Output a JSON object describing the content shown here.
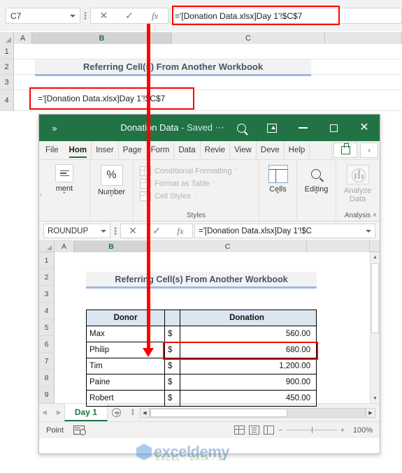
{
  "outer": {
    "name_box": "C7",
    "formula": "='[Donation Data.xlsx]Day 1'!$C$7",
    "columns": [
      "A",
      "B",
      "C"
    ],
    "rows": [
      "1",
      "2",
      "3",
      "4"
    ],
    "title_banner": "Referring Cell(s) From Another Workbook",
    "cell_b4_formula": "='[Donation Data.xlsx]Day 1'!$C$7"
  },
  "inner": {
    "titlebar": {
      "chevron": "»",
      "title": "Donation Data",
      "separator": "-",
      "saved_label": "Saved",
      "more_dots": "⋯",
      "search_icon": "search-icon",
      "present_icon": "present-icon",
      "minimize_icon": "minimize-icon",
      "maximize_icon": "maximize-icon",
      "close_icon": "close-icon"
    },
    "ribbon_tabs": [
      "File",
      "Hom",
      "Inser",
      "Page",
      "Form",
      "Data",
      "Revie",
      "View",
      "Deve",
      "Help"
    ],
    "active_tab": "Hom",
    "overflow_chevron": "›",
    "ribbon_groups": [
      {
        "caption": "ment",
        "label": "",
        "chev": "ˇ"
      },
      {
        "caption": "Number",
        "label": "",
        "chev": "ˇ",
        "glyph": "%"
      },
      {
        "caption": "",
        "label": "Styles",
        "items": [
          {
            "text": "Conditional Formatting",
            "chev": "ˇ"
          },
          {
            "text": "Format as Table",
            "chev": "ˇ"
          },
          {
            "text": "Cell Styles",
            "chev": "ˇ"
          }
        ]
      },
      {
        "caption": "Cells",
        "label": "",
        "chev": "ˇ"
      },
      {
        "caption": "Editing",
        "label": "",
        "chev": "ˇ"
      },
      {
        "caption": "Analyze Data",
        "label": "Analysis"
      }
    ],
    "collapse_ribbon": "˄",
    "formula_bar": {
      "name_box": "ROUNDUP",
      "formula": "='[Donation Data.xlsx]Day 1'!$C",
      "expand_chev": "ˇ"
    },
    "columns": [
      "A",
      "B",
      "C"
    ],
    "rows": [
      "1",
      "2",
      "3",
      "4",
      "5",
      "6",
      "7",
      "8",
      "9"
    ],
    "title_banner": "Referring Cell(s) From Another Workbook",
    "table": {
      "headers": [
        "Donor",
        "",
        "Donation"
      ],
      "currency_symbol": "$",
      "rows": [
        {
          "donor": "Max",
          "currency": "$",
          "amount": "560.00"
        },
        {
          "donor": "Philip",
          "currency": "$",
          "amount": "680.00"
        },
        {
          "donor": "Tim",
          "currency": "$",
          "amount": "1,200.00"
        },
        {
          "donor": "Paine",
          "currency": "$",
          "amount": "900.00"
        },
        {
          "donor": "Robert",
          "currency": "$",
          "amount": "450.00"
        }
      ],
      "highlighted_row_index": 2
    },
    "sheet_tabs": {
      "active": "Day 1",
      "add_label": "new-sheet",
      "prev_icon": "◀",
      "next_icon": "▶"
    },
    "status": {
      "mode": "Point",
      "macro_record": "macro-record-icon",
      "zoom": "100%",
      "zoom_out": "−",
      "zoom_in": "+"
    }
  },
  "watermark": {
    "brand": "exceldemy",
    "tagline": "EXCEL - DATA - BI"
  },
  "colors": {
    "excel_green": "#217346",
    "annotation_red": "#ff0000",
    "table_header_blue": "#dce6f1",
    "banner_text": "#44546a"
  }
}
